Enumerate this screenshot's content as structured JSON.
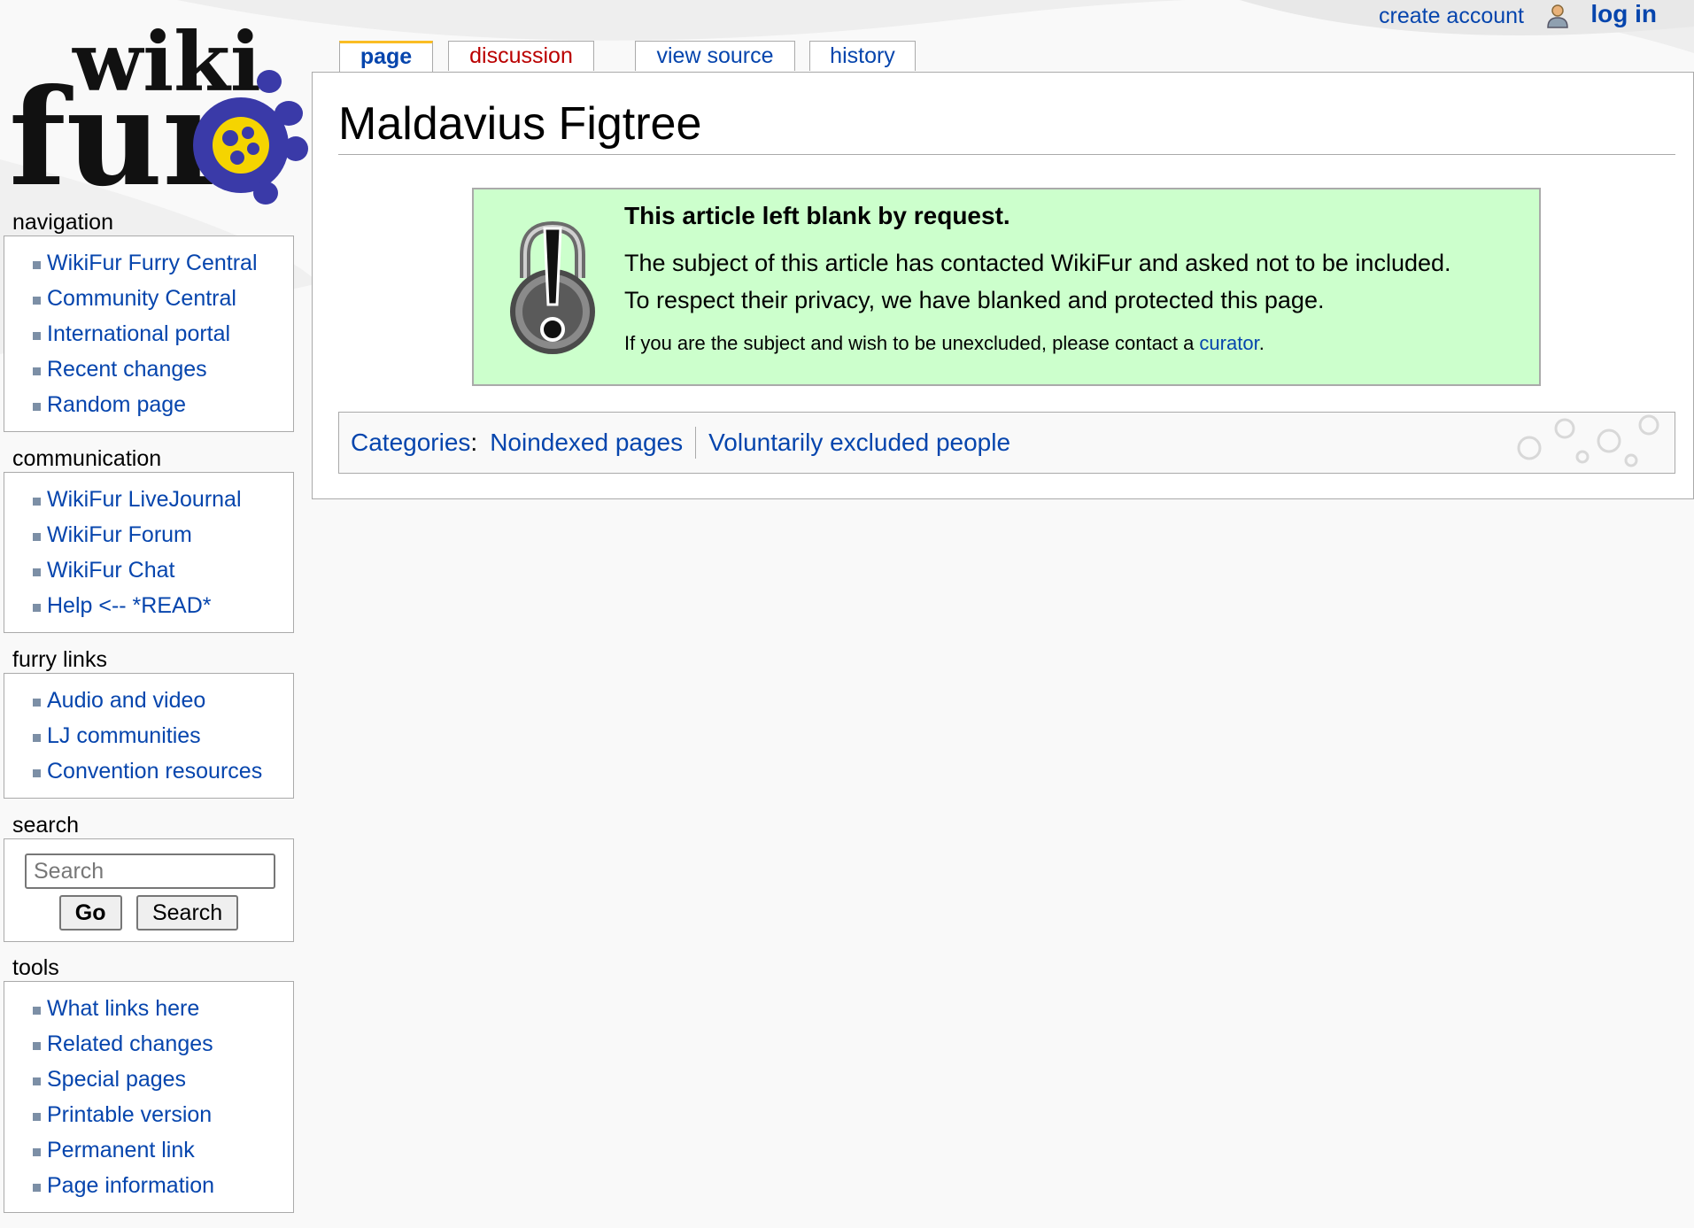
{
  "personal": {
    "create_account": "create account",
    "log_in": "log in"
  },
  "logo": {
    "line1": "wiki",
    "line2": "fur"
  },
  "tabs": {
    "page": "page",
    "discussion": "discussion",
    "view_source": "view source",
    "history": "history"
  },
  "article": {
    "title": "Maldavius Figtree",
    "notice_title": "This article left blank by request.",
    "notice_line1": "The subject of this article has contacted WikiFur and asked not to be included.",
    "notice_line2": "To respect their privacy, we have blanked and protected this page.",
    "notice_line3_prefix": "If you are the subject and wish to be unexcluded, please contact a ",
    "notice_link": "curator",
    "notice_line3_suffix": "."
  },
  "categories": {
    "label": "Categories",
    "colon": ":",
    "items": [
      "Noindexed pages",
      "Voluntarily excluded people"
    ]
  },
  "sidebar": {
    "navigation": {
      "heading": "navigation",
      "items": [
        "WikiFur Furry Central",
        "Community Central",
        "International portal",
        "Recent changes",
        "Random page"
      ]
    },
    "communication": {
      "heading": "communication",
      "items": [
        "WikiFur LiveJournal",
        "WikiFur Forum",
        "WikiFur Chat",
        "Help <-- *READ*"
      ]
    },
    "furry_links": {
      "heading": "furry links",
      "items": [
        "Audio and video",
        "LJ communities",
        "Convention resources"
      ]
    },
    "search": {
      "heading": "search",
      "placeholder": "Search",
      "go": "Go",
      "search_button": "Search"
    },
    "tools": {
      "heading": "tools",
      "items": [
        "What links here",
        "Related changes",
        "Special pages",
        "Printable version",
        "Permanent link",
        "Page information"
      ]
    }
  },
  "colors": {
    "link": "#0645ad",
    "new_link": "#ba0000",
    "notice_bg": "#ccffcc",
    "tab_accent": "#fabd23",
    "paw_blue": "#3a3aa8",
    "paw_yellow": "#f5d400"
  },
  "icons": [
    "user-icon",
    "padlock-exclamation-icon",
    "paw-logo-icon",
    "paw-prints-decoration"
  ]
}
